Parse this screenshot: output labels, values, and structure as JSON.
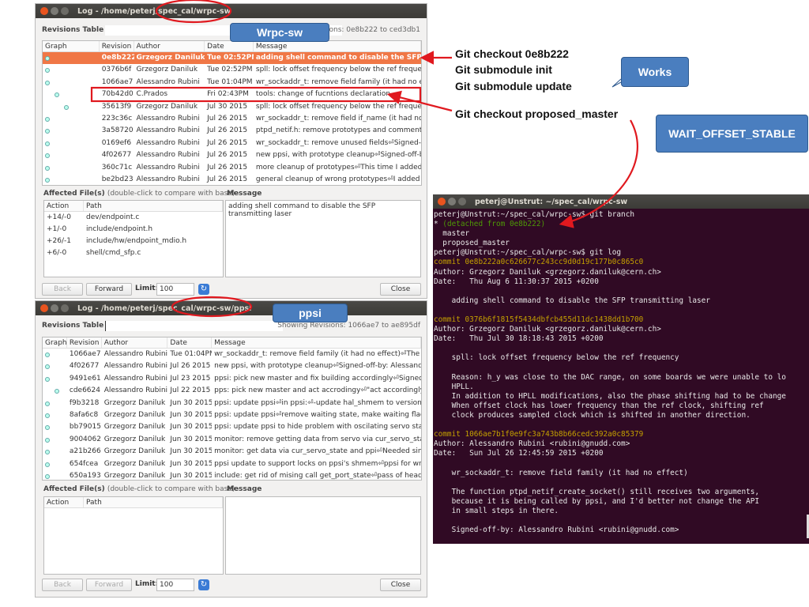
{
  "top_window": {
    "title": "Log - /home/peterj/spec_cal/wrpc-sw",
    "revisions_label": "Revisions Table",
    "showing": "Showing Revisions: 0e8b222 to ced3db1",
    "columns": [
      "Graph",
      "Revision",
      "Author",
      "Date",
      "Message"
    ],
    "rows": [
      [
        "0e8b222",
        "Grzegorz Daniluk",
        "Tue 02:52PM",
        "adding shell command to disable the SFP transmitting laser"
      ],
      [
        "0376b6f",
        "Grzegorz Daniluk",
        "Tue 02:52PM",
        "spll: lock offset frequency below the ref frequency"
      ],
      [
        "1066ae7",
        "Alessandro Rubini",
        "Tue 01:04PM",
        "wr_sockaddr_t: remove field family (it had no effect)"
      ],
      [
        "70b42d0",
        "C.Prados",
        "Fri 02:43PM",
        "tools: change of fucntions declaration"
      ],
      [
        "35613f9",
        "Grzegorz Daniluk",
        "Jul 30 2015",
        "spll: lock offset frequency below the ref frequency"
      ],
      [
        "223c36c",
        "Alessandro Rubini",
        "Jul 26 2015",
        "wr_sockaddr_t: remove field if_name (it had no effect)"
      ],
      [
        "3a58720",
        "Alessandro Rubini",
        "Jul 26 2015",
        "ptpd_netif.h: remove prototypes and comment fo"
      ],
      [
        "0169ef6",
        "Alessandro Rubini",
        "Jul 26 2015",
        "wr_sockaddr_t: remove unused fields⏎Signed-off"
      ],
      [
        "4f02677",
        "Alessandro Rubini",
        "Jul 26 2015",
        "new ppsi, with prototype cleanup⏎Signed-off-by"
      ],
      [
        "360c71c",
        "Alessandro Rubini",
        "Jul 26 2015",
        "more cleanup of prototypes⏎This time I added"
      ],
      [
        "be2bd23",
        "Alessandro Rubini",
        "Jul 26 2015",
        "general cleanup of wrong prototypes⏎I added -"
      ]
    ],
    "affected_label": "Affected File(s)",
    "affected_hint": "(double-click to compare with base)",
    "message_label": "Message",
    "file_columns": [
      "Action",
      "Path"
    ],
    "files": [
      [
        "+14/-0",
        "dev/endpoint.c"
      ],
      [
        "+1/-0",
        "include/endpoint.h"
      ],
      [
        "+26/-1",
        "include/hw/endpoint_mdio.h"
      ],
      [
        "+6/-0",
        "shell/cmd_sfp.c"
      ]
    ],
    "message": "adding shell command to disable the SFP transmitting laser",
    "back": "Back",
    "forward": "Forward",
    "limit_label": "Limit:",
    "limit": "100",
    "close": "Close"
  },
  "bottom_window": {
    "title": "Log - /home/peterj/spec_cal/wrpc-sw/ppsi",
    "revisions_label": "Revisions Table",
    "showing": "Showing Revisions: 1066ae7 to ae895df",
    "columns": [
      "Graph",
      "Revision",
      "Author",
      "Date",
      "Message"
    ],
    "rows": [
      [
        "1066ae7",
        "Alessandro Rubini",
        "Tue 01:04PM",
        "wr_sockaddr_t: remove field family (it had no effect)⏎The f"
      ],
      [
        "4f02677",
        "Alessandro Rubini",
        "Jul 26 2015",
        "new ppsi, with prototype cleanup⏎Signed-off-by: Alessandr"
      ],
      [
        "9491e61",
        "Alessandro Rubini",
        "Jul 23 2015",
        "ppsi: pick new master and fix building accordingly⏎Signed-o"
      ],
      [
        "cde6624",
        "Alessandro Rubini",
        "Jul 22 2015",
        "pps: pick new master and act accrodingy⏎\"act accordingly\""
      ],
      [
        "f9b3218",
        "Grzegorz Daniluk",
        "Jun 30 2015",
        "ppsi: update ppsi⏎in ppsi:⏎-update hal_shmem to version"
      ],
      [
        "8afa6c8",
        "Grzegorz Daniluk",
        "Jun 30 2015",
        "ppsi: update ppsi⏎remove waiting state, make waiting flag"
      ],
      [
        "bb79015",
        "Grzegorz Daniluk",
        "Jun 30 2015",
        "ppsi: update ppsi to hide problem with oscilating servo state"
      ],
      [
        "9004062",
        "Grzegorz Daniluk",
        "Jun 30 2015",
        "monitor: remove getting data from servo via cur_servo_state"
      ],
      [
        "a21b266",
        "Grzegorz Daniluk",
        "Jun 30 2015",
        "monitor: get data via cur_servo_state and ppi⏎Needed sinc"
      ],
      [
        "654fcea",
        "Grzegorz Daniluk",
        "Jun 30 2015",
        "ppsi update to support locks on ppsi's shmem⏎ppsi for wr"
      ],
      [
        "650a193",
        "Grzegorz Daniluk",
        "Jun 30 2015",
        "include: get rid of mising call get_port_state⏎pass of heade"
      ]
    ],
    "affected_label": "Affected File(s)",
    "affected_hint": "(double-click to compare with base)",
    "message_label": "Message",
    "file_columns": [
      "Action",
      "Path"
    ],
    "back": "Back",
    "forward": "Forward",
    "limit_label": "Limit:",
    "limit": "100",
    "close": "Close"
  },
  "terminal": {
    "title": "peterj@Unstrut: ~/spec_cal/wrpc-sw",
    "lines": [
      {
        "t": "peterj@Unstrut:~/spec_cal/wrpc-sw$ git branch"
      },
      {
        "t": "* ",
        "c": "",
        "g": "(detached from 0e8b222)"
      },
      {
        "t": "  master"
      },
      {
        "t": "  proposed_master"
      },
      {
        "t": "peterj@Unstrut:~/spec_cal/wrpc-sw$ git log"
      },
      {
        "t": "commit 0e8b222a0c626677c243cc9d0d19c177b0c865c0",
        "c": "y"
      },
      {
        "t": "Author: Grzegorz Daniluk <grzegorz.daniluk@cern.ch>"
      },
      {
        "t": "Date:   Thu Aug 6 11:30:37 2015 +0200"
      },
      {
        "t": ""
      },
      {
        "t": "    adding shell command to disable the SFP transmitting laser"
      },
      {
        "t": ""
      },
      {
        "t": "commit 0376b6f1815f5434dbfcb455d11dc1438dd1b700",
        "c": "y"
      },
      {
        "t": "Author: Grzegorz Daniluk <grzegorz.daniluk@cern.ch>"
      },
      {
        "t": "Date:   Thu Jul 30 18:18:43 2015 +0200"
      },
      {
        "t": ""
      },
      {
        "t": "    spll: lock offset frequency below the ref frequency"
      },
      {
        "t": ""
      },
      {
        "t": "    Reason: h_y was close to the DAC range, on some boards we were unable to lo"
      },
      {
        "t": "    HPLL."
      },
      {
        "t": "    In addition to HPLL modifications, also the phase shifting had to be change"
      },
      {
        "t": "    When offset clock has lower frequency than the ref clock, shifting ref"
      },
      {
        "t": "    clock produces sampled clock which is shifted in another direction."
      },
      {
        "t": ""
      },
      {
        "t": "commit 1066ae7b1f0e9fc3a743b8b66cedc392a0c85379",
        "c": "y"
      },
      {
        "t": "Author: Alessandro Rubini <rubini@gnudd.com>"
      },
      {
        "t": "Date:   Sun Jul 26 12:45:59 2015 +0200"
      },
      {
        "t": ""
      },
      {
        "t": "    wr_sockaddr_t: remove field family (it had no effect)"
      },
      {
        "t": ""
      },
      {
        "t": "    The function ptpd_netif_create_socket() still receives two arguments,"
      },
      {
        "t": "    because it is being called by ppsi, and I'd better not change the API"
      },
      {
        "t": "    in small steps in there."
      },
      {
        "t": ""
      },
      {
        "t": "    Signed-off-by: Alessandro Rubini <rubini@gnudd.com>"
      }
    ]
  },
  "annotations": {
    "wrpc": "Wrpc-sw",
    "ppsi": "ppsi",
    "works": "Works",
    "wait": "WAIT_OFFSET_STABLE",
    "steps": [
      "Git checkout 0e8b222",
      "Git submodule init",
      "Git submodule update"
    ],
    "proposed": "Git checkout proposed_master"
  },
  "colors": {
    "selection": "#f07746",
    "annotation_red": "#e0191f",
    "callout_blue": "#4a7ebf",
    "terminal_bg": "#300a24"
  }
}
